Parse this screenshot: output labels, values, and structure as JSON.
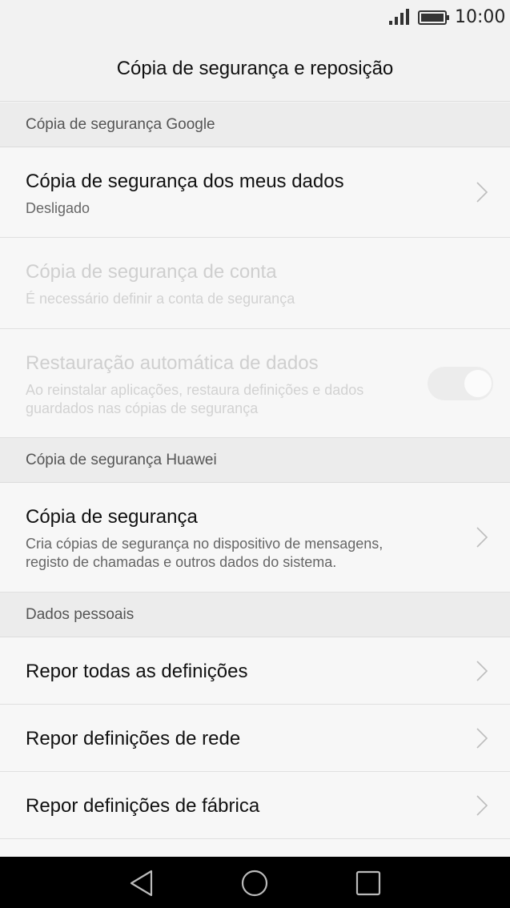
{
  "status_bar": {
    "time": "10:00",
    "icons": [
      "signal-icon",
      "battery-icon"
    ]
  },
  "header": {
    "title": "Cópia de segurança e reposição"
  },
  "sections": {
    "google": "Cópia de segurança Google",
    "huawei": "Cópia de segurança Huawei",
    "personal": "Dados pessoais"
  },
  "items": {
    "backup_my_data": {
      "title": "Cópia de segurança dos meus dados",
      "subtitle": "Desligado"
    },
    "backup_account": {
      "title": "Cópia de segurança de conta",
      "subtitle": "É necessário definir a conta de segurança"
    },
    "auto_restore": {
      "title": "Restauração automática de dados",
      "subtitle_line1": "Ao reinstalar aplicações, restaura definições e dados",
      "subtitle_line2": "guardados nas cópias de segurança",
      "enabled": false
    },
    "huawei_backup": {
      "title": "Cópia de segurança",
      "subtitle_line1": "Cria cópias de segurança no dispositivo de mensagens,",
      "subtitle_line2": "registo de chamadas e outros dados do sistema."
    },
    "reset_all": {
      "title": "Repor todas as definições"
    },
    "reset_network": {
      "title": "Repor definições de rede"
    },
    "factory_reset": {
      "title": "Repor definições de fábrica"
    }
  },
  "nav_bar": {
    "icons": [
      "back-icon",
      "home-icon",
      "recents-icon"
    ]
  },
  "colors": {
    "background": "#f7f7f7",
    "section_background": "#ececec",
    "disabled_text": "#cfcfcf",
    "nav_background": "#000000"
  }
}
